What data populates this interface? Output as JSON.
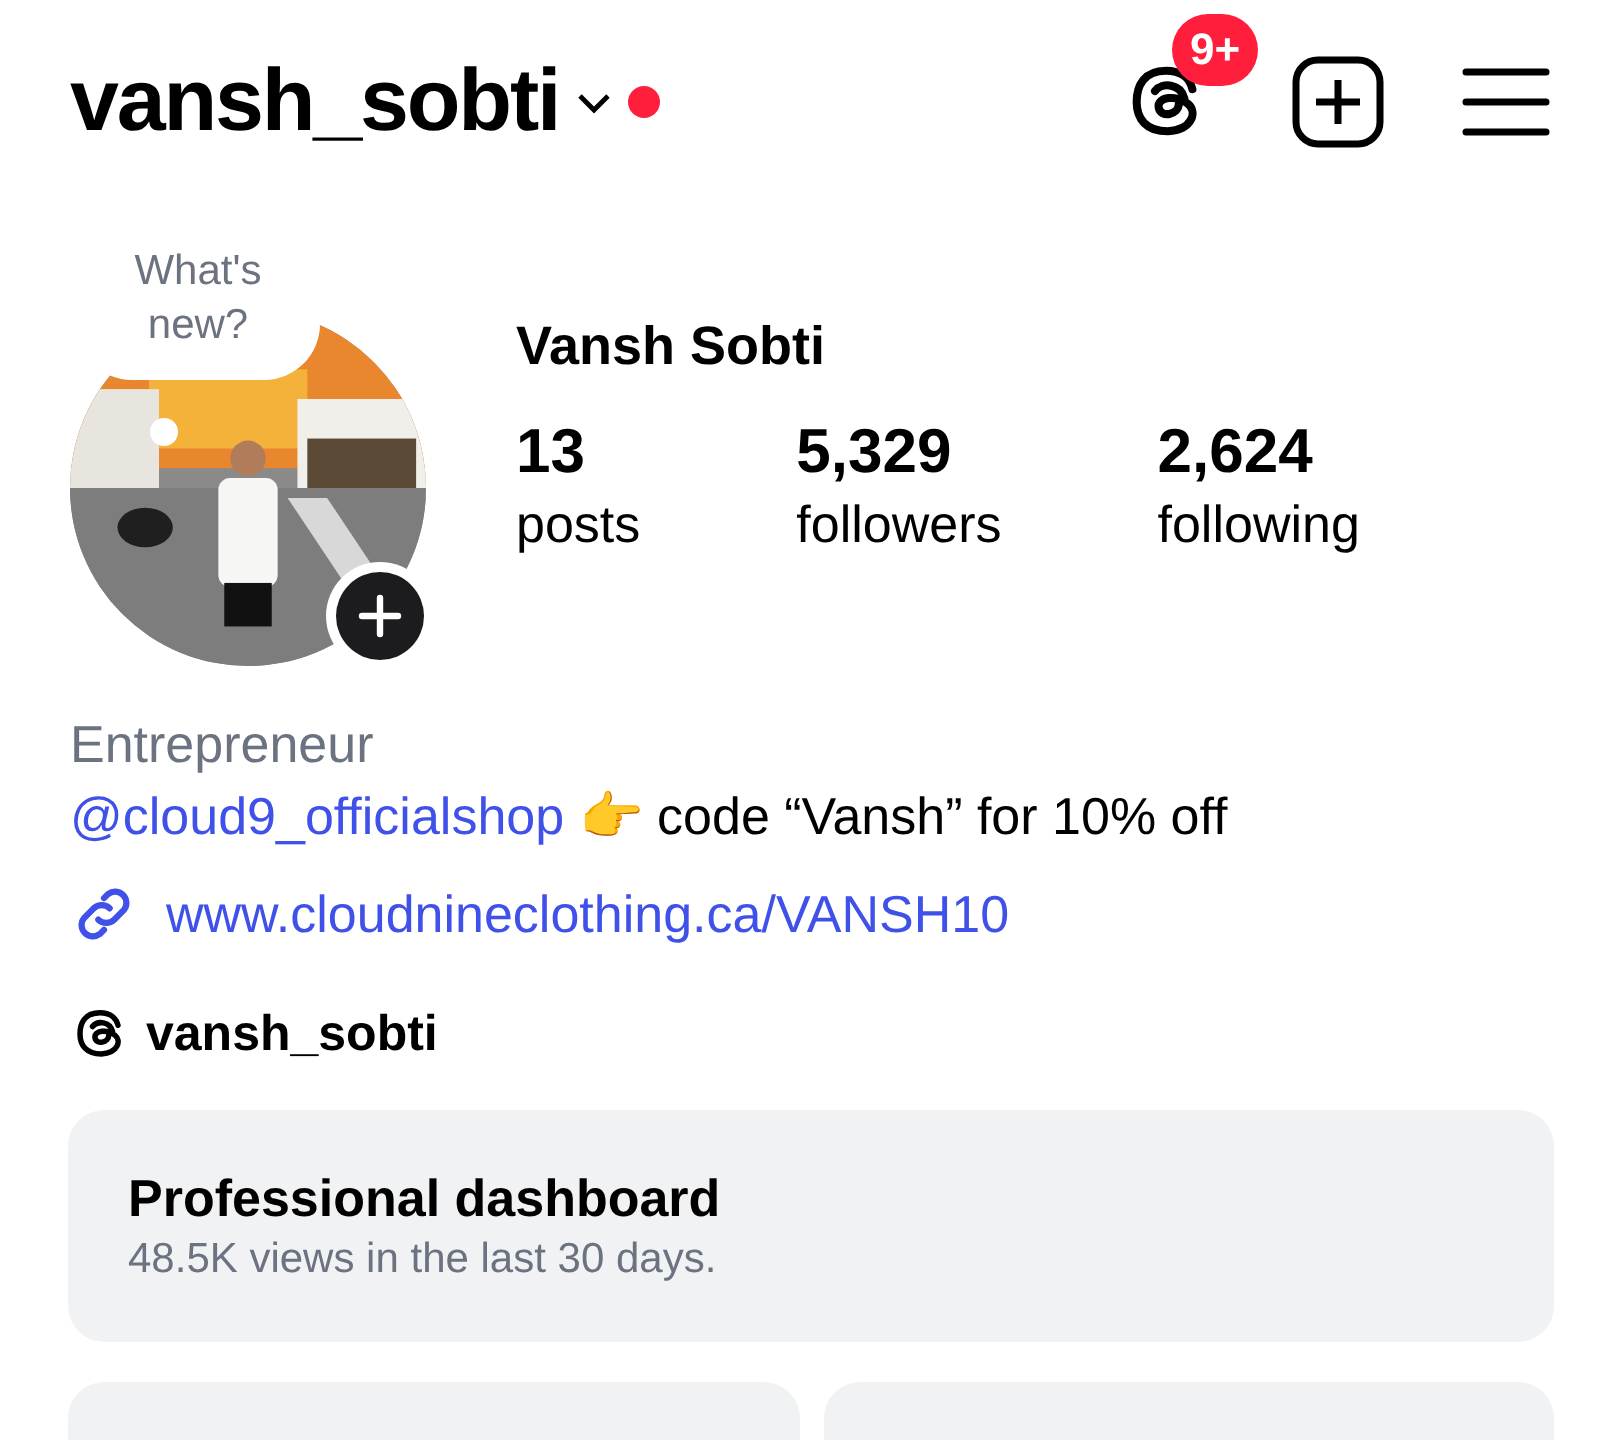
{
  "header": {
    "username": "vansh_sobti",
    "threads_badge": "9+"
  },
  "profile": {
    "bubble": "What's new?",
    "name": "Vansh Sobti",
    "stats": [
      {
        "value": "13",
        "label": "posts"
      },
      {
        "value": "5,329",
        "label": "followers"
      },
      {
        "value": "2,624",
        "label": "following"
      }
    ]
  },
  "bio": {
    "category": "Entrepreneur",
    "mention": "@cloud9_officialshop",
    "text": " 👉 code “Vansh” for 10% off",
    "link": "www.cloudnineclothing.ca/VANSH10",
    "threads_handle": "vansh_sobti"
  },
  "dashboard": {
    "title": "Professional dashboard",
    "subtitle": "48.5K views in the last 30 days."
  }
}
